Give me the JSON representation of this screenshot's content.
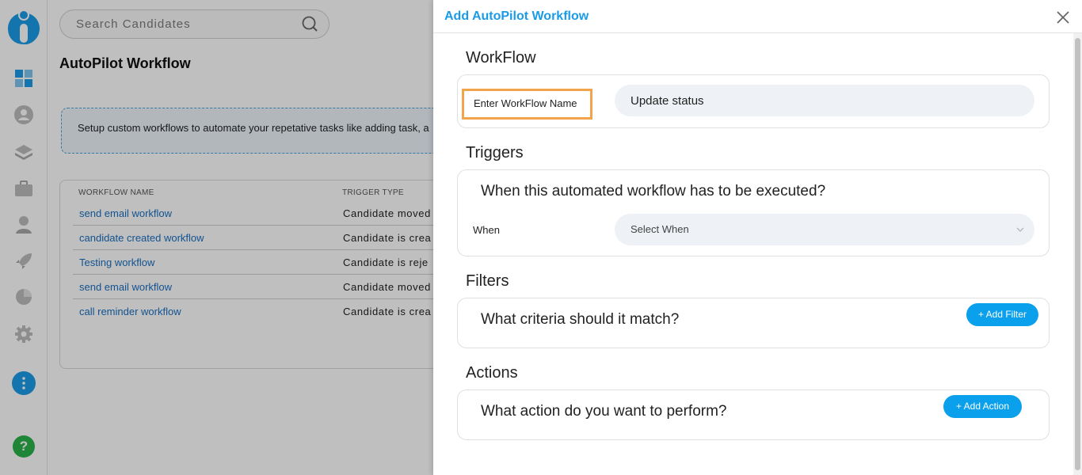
{
  "sidebar": {
    "icons": [
      "logo-icon",
      "dashboard-icon",
      "user-icon",
      "layers-icon",
      "briefcase-icon",
      "recruiter-icon",
      "rocket-icon",
      "pie-chart-icon",
      "gear-icon",
      "more-icon",
      "help-icon"
    ],
    "help_label": "?"
  },
  "search": {
    "placeholder": "Search Candidates"
  },
  "page": {
    "title": "AutoPilot Workflow",
    "info_text": "Setup custom workflows to automate your repetative tasks like adding task, a"
  },
  "table": {
    "headers": [
      "WORKFLOW NAME",
      "TRIGGER TYPE"
    ],
    "rows": [
      {
        "name": "send email workflow",
        "trigger": "Candidate moved"
      },
      {
        "name": "candidate created workflow",
        "trigger": "Candidate is crea"
      },
      {
        "name": "Testing workflow",
        "trigger": "Candidate is reje"
      },
      {
        "name": "send email workflow",
        "trigger": "Candidate moved"
      },
      {
        "name": "call reminder workflow",
        "trigger": "Candidate is crea"
      }
    ]
  },
  "modal": {
    "title": "Add AutoPilot Workflow",
    "workflow": {
      "section_title": "WorkFlow",
      "name_label": "Enter WorkFlow Name",
      "name_value": "Update status"
    },
    "triggers": {
      "section_title": "Triggers",
      "question": "When this automated workflow has to be executed?",
      "when_label": "When",
      "select_placeholder": "Select When"
    },
    "filters": {
      "section_title": "Filters",
      "question": "What criteria should it match?",
      "button": "+ Add Filter"
    },
    "actions": {
      "section_title": "Actions",
      "question": "What action do you want to perform?",
      "button": "+ Add Action"
    }
  },
  "colors": {
    "brand_blue": "#1a9be8",
    "button_blue": "#0aa0ec",
    "highlight_orange": "#f2a44a",
    "link_blue": "#1a6fc0",
    "help_green": "#2bb34a"
  }
}
